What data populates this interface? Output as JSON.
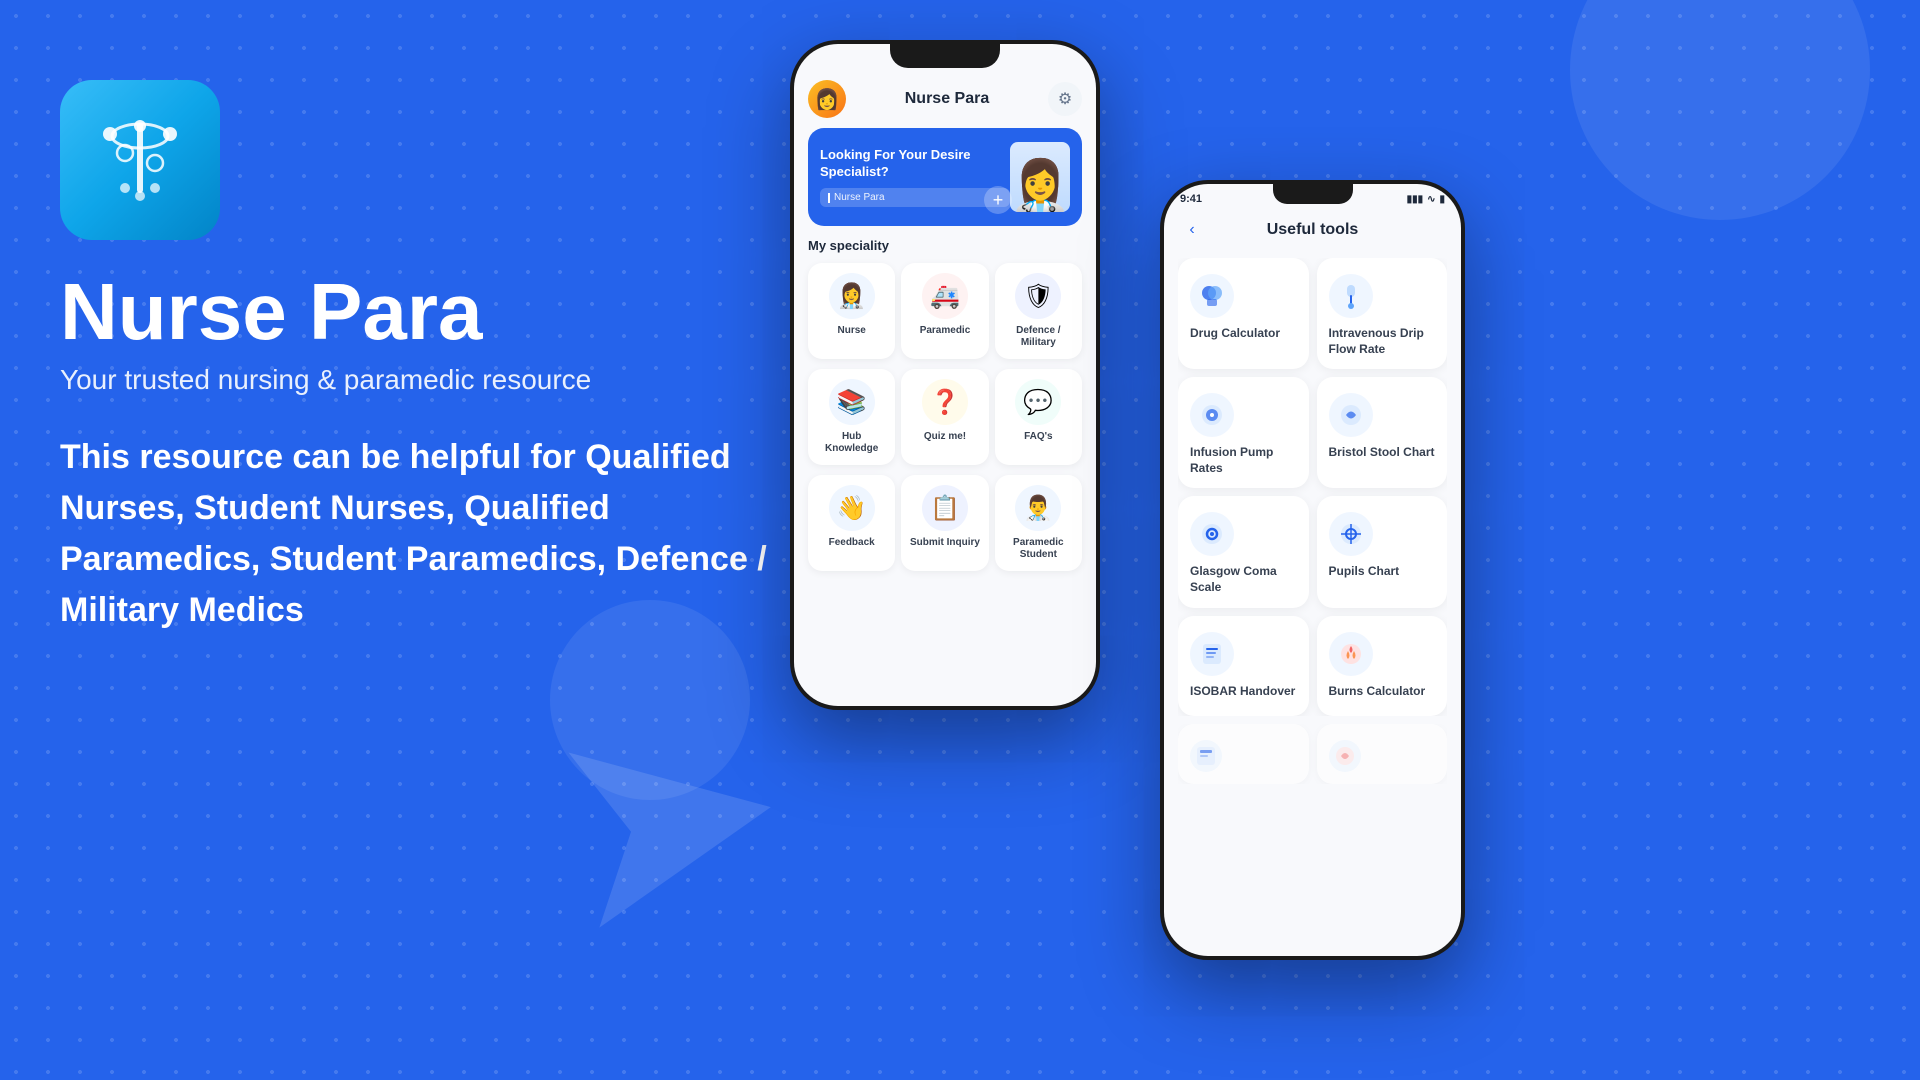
{
  "background": {
    "color": "#2563eb"
  },
  "app": {
    "icon_emoji": "⚕",
    "title": "Nurse Para",
    "subtitle": "Your trusted nursing & paramedic resource",
    "description": "This resource can be helpful for Qualified Nurses, Student Nurses, Qualified Paramedics, Student Paramedics, Defence / Military Medics"
  },
  "phone_main": {
    "header": {
      "title": "Nurse Para",
      "gear_icon": "⚙"
    },
    "banner": {
      "heading": "Looking For Your Desire Specialist?",
      "placeholder": "Nurse Para"
    },
    "speciality_title": "My speciality",
    "grid_items": [
      {
        "label": "Nurse",
        "emoji": "👩‍⚕️",
        "color_class": "icon-blue"
      },
      {
        "label": "Paramedic",
        "emoji": "🚑",
        "color_class": "icon-red"
      },
      {
        "label": "Defence / Military",
        "emoji": "🛡",
        "color_class": "icon-indigo"
      },
      {
        "label": "Hub Knowledge",
        "emoji": "📚",
        "color_class": "icon-blue"
      },
      {
        "label": "Quiz me!",
        "emoji": "❓",
        "color_class": "icon-amber"
      },
      {
        "label": "FAQ's",
        "emoji": "💬",
        "color_class": "icon-teal"
      },
      {
        "label": "Feedback",
        "emoji": "👋",
        "color_class": "icon-blue"
      },
      {
        "label": "Submit Inquiry",
        "emoji": "📋",
        "color_class": "icon-indigo"
      },
      {
        "label": "Paramedic Student",
        "emoji": "👨‍⚕️",
        "color_class": "icon-blue"
      }
    ]
  },
  "phone_secondary": {
    "status_time": "9:41",
    "header": {
      "back_label": "‹",
      "title": "Useful tools"
    },
    "tools": [
      {
        "label": "Drug Calculator",
        "emoji": "💊"
      },
      {
        "label": "Intravenous Drip Flow Rate",
        "emoji": "💉"
      },
      {
        "label": "Infusion Pump Rates",
        "emoji": "🏥"
      },
      {
        "label": "Bristol Stool Chart",
        "emoji": "⚙"
      },
      {
        "label": "Glasgow Coma Scale",
        "emoji": "🔵"
      },
      {
        "label": "Pupils Chart",
        "emoji": "🎯"
      },
      {
        "label": "ISOBAR Handover",
        "emoji": "📄"
      },
      {
        "label": "Burns Calculator",
        "emoji": "🔥"
      }
    ]
  }
}
